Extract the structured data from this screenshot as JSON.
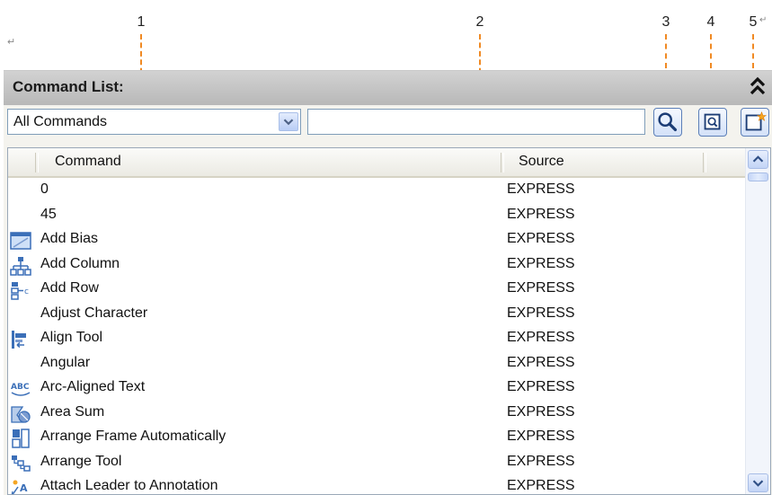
{
  "callouts": [
    "1",
    "2",
    "3",
    "4",
    "5"
  ],
  "header": {
    "title": "Command List:"
  },
  "filter": {
    "selected": "All Commands",
    "search_value": ""
  },
  "columns": {
    "command": "Command",
    "source": "Source"
  },
  "rows": [
    {
      "name": "0",
      "source": "EXPRESS",
      "icon": "none"
    },
    {
      "name": "45",
      "source": "EXPRESS",
      "icon": "none"
    },
    {
      "name": "Add Bias",
      "source": "EXPRESS",
      "icon": "add-bias-icon"
    },
    {
      "name": "Add Column",
      "source": "EXPRESS",
      "icon": "add-column-icon"
    },
    {
      "name": "Add Row",
      "source": "EXPRESS",
      "icon": "add-row-icon"
    },
    {
      "name": "Adjust Character",
      "source": "EXPRESS",
      "icon": "none"
    },
    {
      "name": "Align Tool",
      "source": "EXPRESS",
      "icon": "align-tool-icon"
    },
    {
      "name": "Angular",
      "source": "EXPRESS",
      "icon": "none"
    },
    {
      "name": "Arc-Aligned Text",
      "source": "EXPRESS",
      "icon": "arc-text-icon"
    },
    {
      "name": "Area Sum",
      "source": "EXPRESS",
      "icon": "area-sum-icon"
    },
    {
      "name": "Arrange Frame Automatically",
      "source": "EXPRESS",
      "icon": "arrange-frame-icon"
    },
    {
      "name": "Arrange Tool",
      "source": "EXPRESS",
      "icon": "arrange-tool-icon"
    },
    {
      "name": "Attach Leader to Annotation",
      "source": "EXPRESS",
      "icon": "attach-leader-icon"
    }
  ],
  "colors": {
    "callout": "#f08a24",
    "header_bg": "#c4c4c4",
    "accent": "#1f5fbf"
  }
}
